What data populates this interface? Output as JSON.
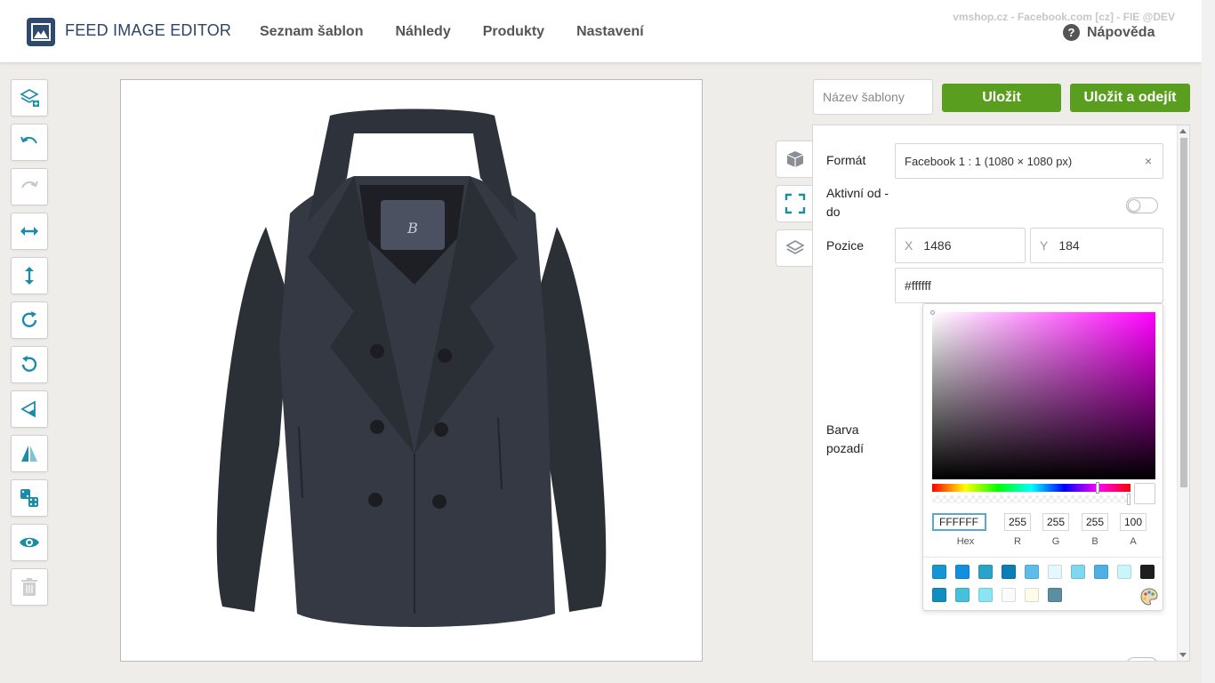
{
  "app": {
    "brand": "FEED IMAGE EDITOR",
    "shop_info": "vmshop.cz - Facebook.com [cz] - FIE @DEV",
    "help_label": "Nápověda"
  },
  "nav": {
    "items": [
      "Seznam šablon",
      "Náhledy",
      "Produkty",
      "Nastavení"
    ]
  },
  "toolbar": {
    "tools": [
      {
        "name": "add-layer-icon"
      },
      {
        "name": "undo-icon"
      },
      {
        "name": "redo-icon"
      },
      {
        "name": "stretch-horizontal-icon"
      },
      {
        "name": "stretch-vertical-icon"
      },
      {
        "name": "rotate-right-icon"
      },
      {
        "name": "rotate-left-icon"
      },
      {
        "name": "triangle-left-icon"
      },
      {
        "name": "flip-icon"
      },
      {
        "name": "dice-icon"
      },
      {
        "name": "eye-icon"
      },
      {
        "name": "trash-icon"
      }
    ]
  },
  "header_actions": {
    "template_name_placeholder": "Název šablony",
    "template_name_value": "",
    "save_label": "Uložit",
    "save_exit_label": "Uložit a odejít"
  },
  "properties": {
    "format_label": "Formát",
    "format_value": "Facebook 1 : 1 (1080 × 1080 px)",
    "format_clear": "×",
    "active_label": "Aktivní od - do",
    "position_label": "Pozice",
    "x_prefix": "X",
    "x_value": "1486",
    "y_prefix": "Y",
    "y_value": "184",
    "bg_color_value": "#ffffff",
    "bg_label": "Barva pozadí"
  },
  "color_picker": {
    "hex": "FFFFFF",
    "r": "255",
    "g": "255",
    "b": "255",
    "a": "100",
    "labels": {
      "hex": "Hex",
      "r": "R",
      "g": "G",
      "b": "B",
      "a": "A"
    },
    "swatches_row1": [
      "#1595d3",
      "#138fe0",
      "#2aa3c9",
      "#0b7fb5",
      "#5dbde8",
      "#e5f8fb",
      "#7fd7f0",
      "#4fb0e8",
      "#c9f7f9",
      "#1e1e1e"
    ],
    "swatches_row2": [
      "#0e8fbf",
      "#45c1d9",
      "#8ae4f3",
      "#fbfbfb",
      "#fdfbe9",
      "#5b8ea0"
    ]
  },
  "colors": {
    "accent": "#1a8ca8",
    "green": "#5a9e1f",
    "brand_blue": "#2c4466"
  }
}
